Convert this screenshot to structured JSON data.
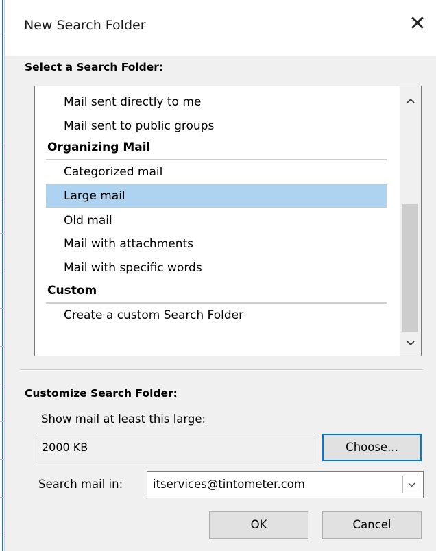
{
  "dialog": {
    "title": "New Search Folder",
    "close_glyph": "✕"
  },
  "select_section": {
    "label": "Select a Search Folder:",
    "list": [
      {
        "kind": "item",
        "label": "Mail sent directly to me",
        "selected": false
      },
      {
        "kind": "item",
        "label": "Mail sent to public groups",
        "selected": false
      },
      {
        "kind": "group",
        "label": "Organizing Mail"
      },
      {
        "kind": "item",
        "label": "Categorized mail",
        "selected": false
      },
      {
        "kind": "item",
        "label": "Large mail",
        "selected": true
      },
      {
        "kind": "item",
        "label": "Old mail",
        "selected": false
      },
      {
        "kind": "item",
        "label": "Mail with attachments",
        "selected": false
      },
      {
        "kind": "item",
        "label": "Mail with specific words",
        "selected": false
      },
      {
        "kind": "group",
        "label": "Custom"
      },
      {
        "kind": "item",
        "label": "Create a custom Search Folder",
        "selected": false
      }
    ],
    "scroll_up_icon": "chevron-up-icon",
    "scroll_down_icon": "chevron-down-icon"
  },
  "customize_section": {
    "label": "Customize Search Folder:",
    "size_label": "Show mail at least this large:",
    "size_value": "2000 KB",
    "choose_button": "Choose...",
    "search_in_label": "Search mail in:",
    "search_in_value": "itservices@tintometer.com"
  },
  "footer": {
    "ok_button": "OK",
    "cancel_button": "Cancel"
  },
  "colors": {
    "selection": "#add3f0",
    "default_button_border": "#0078d7",
    "window_accent": "#2b6cc4",
    "dialog_background": "#f0f0f0"
  }
}
